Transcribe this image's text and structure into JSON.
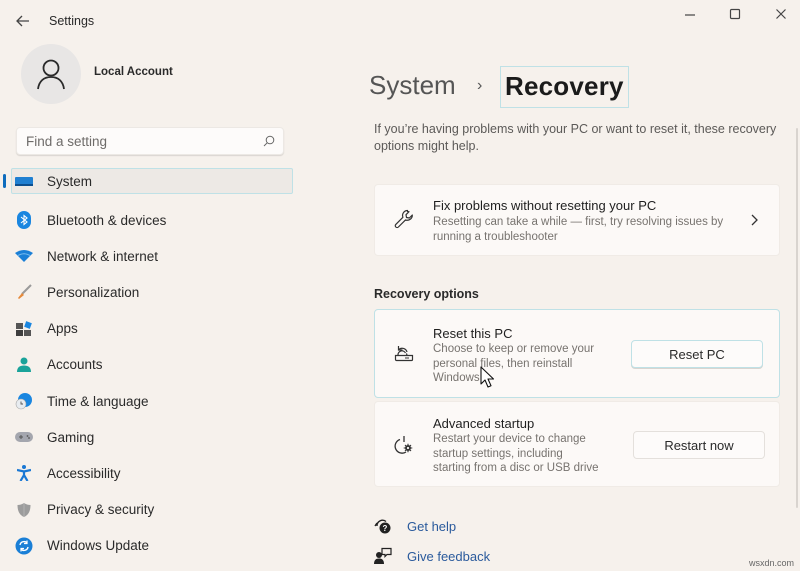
{
  "window": {
    "title": "Settings",
    "controls": {
      "minimize": "minimize-icon",
      "maximize": "maximize-icon",
      "close": "close-icon"
    }
  },
  "profile": {
    "name": "Local Account",
    "avatar_icon": "person-icon"
  },
  "search": {
    "placeholder": "Find a setting",
    "value": "",
    "icon": "search-icon"
  },
  "sidebar": {
    "active_index": 0,
    "items": [
      {
        "label": "System",
        "icon": "monitor-icon",
        "color": "#1f7fd1"
      },
      {
        "label": "Bluetooth & devices",
        "icon": "bluetooth-icon",
        "color": "#1a86e0"
      },
      {
        "label": "Network & internet",
        "icon": "wifi-icon",
        "color": "#1a7fd6"
      },
      {
        "label": "Personalization",
        "icon": "brush-icon",
        "color": "#e58a3c"
      },
      {
        "label": "Apps",
        "icon": "apps-icon",
        "color": "#4a4a4a"
      },
      {
        "label": "Accounts",
        "icon": "account-icon",
        "color": "#1aa39a"
      },
      {
        "label": "Time & language",
        "icon": "clock-globe-icon",
        "color": "#1a86e0"
      },
      {
        "label": "Gaming",
        "icon": "gamepad-icon",
        "color": "#8c8c94"
      },
      {
        "label": "Accessibility",
        "icon": "accessibility-icon",
        "color": "#1a78d4"
      },
      {
        "label": "Privacy & security",
        "icon": "shield-icon",
        "color": "#8f8f8f"
      },
      {
        "label": "Windows Update",
        "icon": "update-icon",
        "color": "#1a7fd6"
      }
    ]
  },
  "main": {
    "breadcrumb": {
      "parent": "System",
      "separator": "›",
      "current": "Recovery"
    },
    "intro": "If you’re having problems with your PC or want to reset it, these recovery options might help.",
    "fix_card": {
      "title": "Fix problems without resetting your PC",
      "description": "Resetting can take a while — first, try resolving issues by running a troubleshooter",
      "icon": "wrench-icon"
    },
    "section_title": "Recovery options",
    "options": [
      {
        "title": "Reset this PC",
        "description_lines": [
          "Choose to keep or remove your",
          "personal files, then reinstall",
          "Windows"
        ],
        "button": "Reset PC",
        "icon": "reset-pc-icon"
      },
      {
        "title": "Advanced startup",
        "description_lines": [
          "Restart your device to change",
          "startup settings, including",
          "starting from a disc or USB drive"
        ],
        "button": "Restart now",
        "icon": "power-gear-icon"
      }
    ],
    "links": [
      {
        "label": "Get help",
        "icon": "help-icon"
      },
      {
        "label": "Give feedback",
        "icon": "feedback-icon"
      }
    ]
  },
  "watermark": "wsxdn.com",
  "colors": {
    "accent": "#0f6cbd",
    "focus_border": "#bfe1e6",
    "link": "#2a5a9c",
    "background": "#f6f1ec",
    "card": "#fcf9f7"
  }
}
